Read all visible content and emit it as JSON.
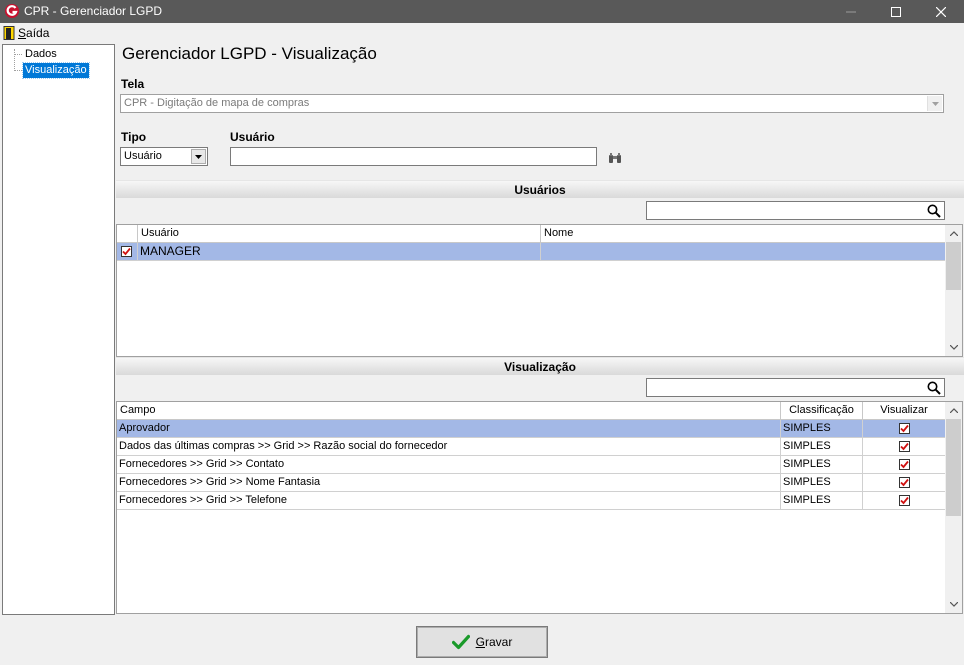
{
  "window": {
    "title": "CPR - Gerenciador LGPD",
    "buttons": {
      "minimize": "minimize-icon",
      "maximize": "maximize-icon",
      "close": "close-icon"
    }
  },
  "menu": {
    "saida": "Saída"
  },
  "tree": {
    "items": [
      {
        "label": "Dados"
      },
      {
        "label": "Visualização",
        "selected": true
      }
    ]
  },
  "page_title": "Gerenciador LGPD - Visualização",
  "tela": {
    "label": "Tela",
    "value": "CPR - Digitação de mapa de compras"
  },
  "tipo": {
    "label": "Tipo",
    "value": "Usuário"
  },
  "usuario": {
    "label": "Usuário",
    "value": ""
  },
  "usuarios_section": {
    "title": "Usuários",
    "search_value": "",
    "columns": [
      "Usuário",
      "Nome"
    ],
    "rows": [
      {
        "checked": true,
        "usuario": "MANAGER",
        "nome": ""
      }
    ]
  },
  "visualizacao_section": {
    "title": "Visualização",
    "search_value": "",
    "columns": [
      "Campo",
      "Classificação",
      "Visualizar"
    ],
    "rows": [
      {
        "campo": "Aprovador",
        "classificacao": "SIMPLES",
        "visualizar": true
      },
      {
        "campo": "Dados das últimas compras >> Grid >> Razão social do fornecedor",
        "classificacao": "SIMPLES",
        "visualizar": true
      },
      {
        "campo": "Fornecedores >> Grid >> Contato",
        "classificacao": "SIMPLES",
        "visualizar": true
      },
      {
        "campo": "Fornecedores >> Grid >> Nome Fantasia",
        "classificacao": "SIMPLES",
        "visualizar": true
      },
      {
        "campo": "Fornecedores >> Grid >> Telefone",
        "classificacao": "SIMPLES",
        "visualizar": true
      }
    ]
  },
  "save_button": {
    "label": "Gravar",
    "icon": "checkmark-icon"
  },
  "colors": {
    "titlebar": "#595959",
    "selection": "#a3b8e6",
    "tree_selection": "#0078d7",
    "check": "#d01010"
  }
}
